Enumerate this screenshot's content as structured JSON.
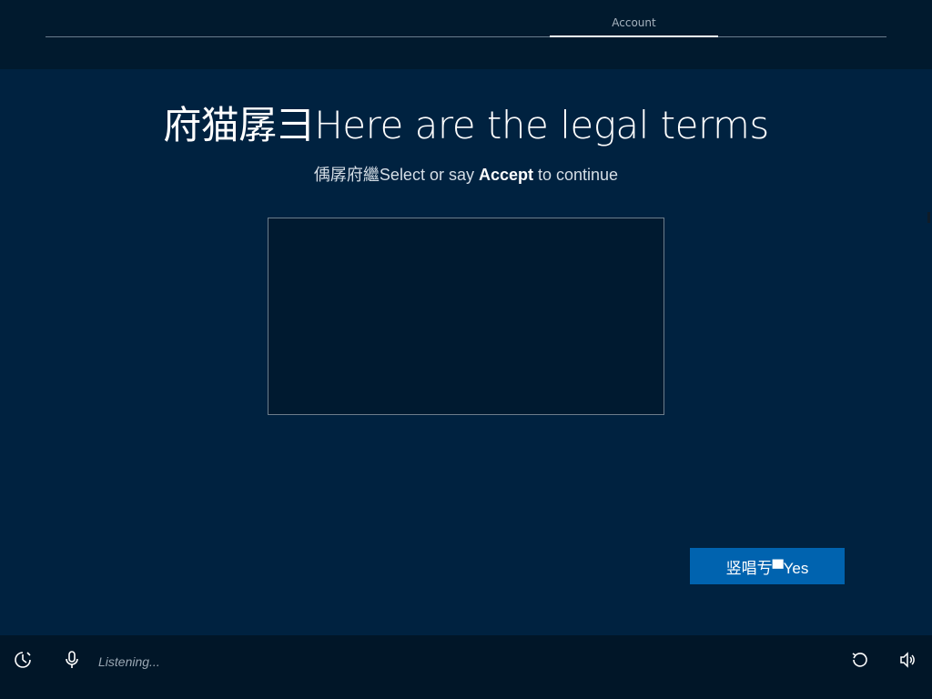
{
  "header": {
    "step_label": "Account"
  },
  "main": {
    "title": "府猫孱彐Here are the legal terms",
    "subtitle_prefix": "偊孱府繼Select or say ",
    "subtitle_bold": "Accept",
    "subtitle_suffix": " to continue",
    "accept_button_label": "竖唱亐▀Yes"
  },
  "footer": {
    "listening_text": "Listening..."
  },
  "icons": {
    "ease_of_access": "ease-of-access-icon",
    "microphone": "microphone-icon",
    "refresh": "refresh-icon",
    "volume": "volume-icon"
  },
  "colors": {
    "background": "#002240",
    "topbar": "#011a2e",
    "bottombar": "#011628",
    "button": "#0063af",
    "terms_box": "#001a30"
  }
}
